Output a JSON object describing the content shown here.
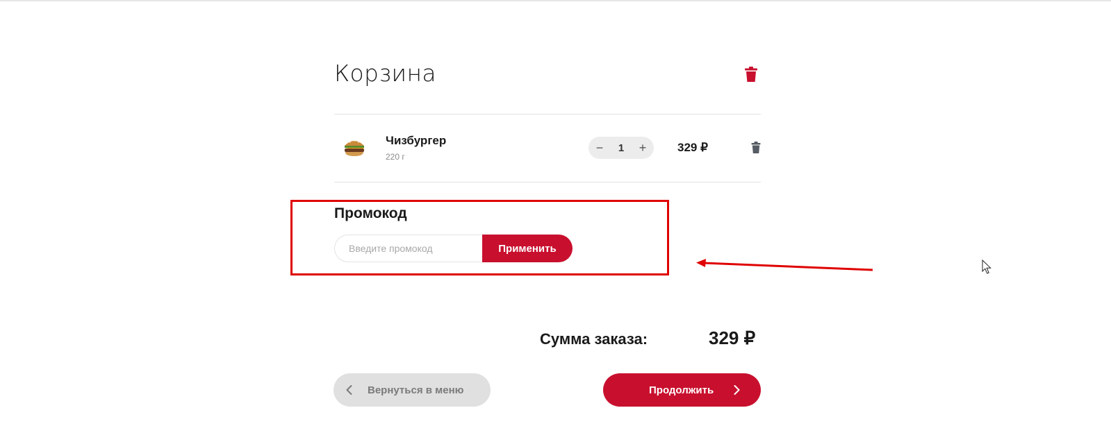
{
  "cart": {
    "title": "Корзина",
    "clear_icon": "trash-icon",
    "items": [
      {
        "name": "Чизбургер",
        "weight": "220 г",
        "quantity": "1",
        "price": "329 ₽",
        "image_icon": "burger-icon",
        "decrement_label": "−",
        "increment_label": "+",
        "delete_icon": "trash-icon"
      }
    ]
  },
  "promo": {
    "title": "Промокод",
    "placeholder": "Введите промокод",
    "value": "",
    "apply_label": "Применить"
  },
  "summary": {
    "total_label": "Сумма заказа:",
    "total_value": "329 ₽"
  },
  "actions": {
    "back_label": "Вернуться в меню",
    "continue_label": "Продолжить"
  },
  "colors": {
    "accent": "#c8102e",
    "annotation": "#e00000",
    "secondary_button": "#e0e0e0",
    "stepper_bg": "#ececec"
  }
}
